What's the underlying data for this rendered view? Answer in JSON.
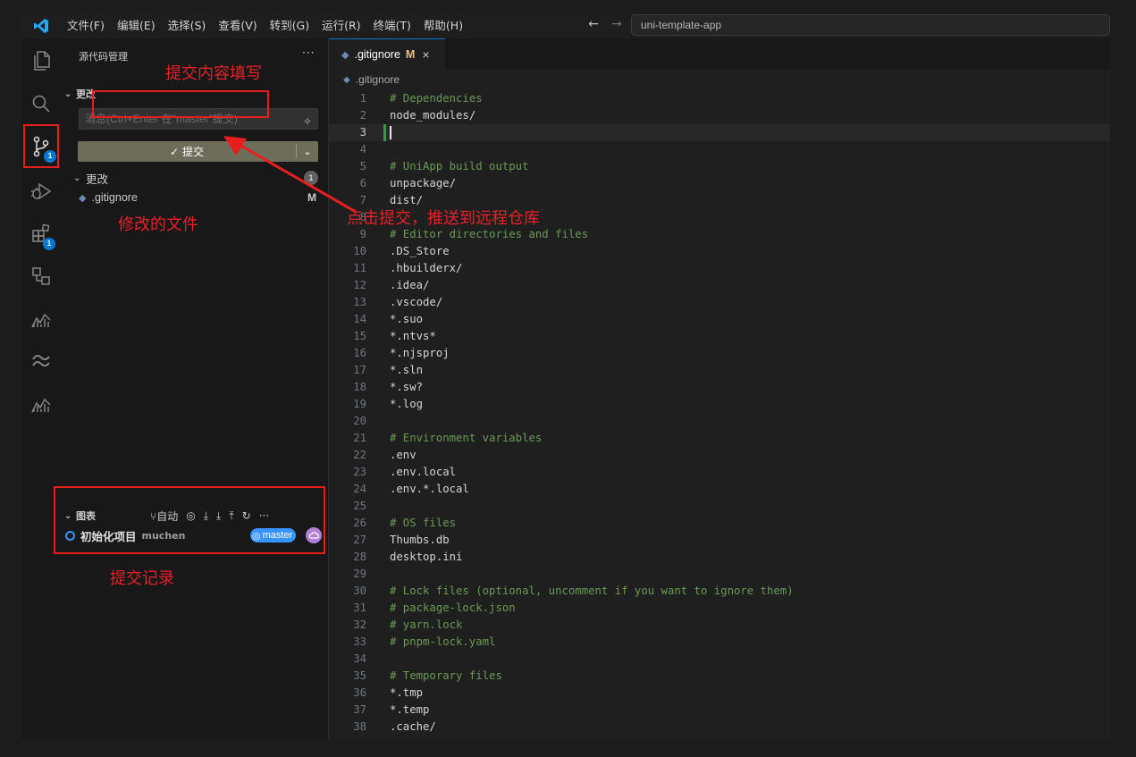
{
  "colors": {
    "accent": "#0078d4",
    "annotation": "#e81e1e",
    "commit_button": "#6e6d5a",
    "modified": "#e2c08d",
    "comment": "#6a9955"
  },
  "titlebar": {
    "menu": [
      "文件(F)",
      "编辑(E)",
      "选择(S)",
      "查看(V)",
      "转到(G)",
      "运行(R)",
      "终端(T)",
      "帮助(H)"
    ],
    "back_icon": "←",
    "forward_icon": "→",
    "command_center": "uni-template-app"
  },
  "activitybar": {
    "items": [
      {
        "icon": "explorer-icon"
      },
      {
        "icon": "search-icon"
      },
      {
        "icon": "source-control-icon",
        "badge": "1"
      },
      {
        "icon": "run-debug-icon"
      },
      {
        "icon": "extensions-icon",
        "badge": "1"
      },
      {
        "icon": "remote-explorer-icon"
      },
      {
        "icon": "chart-icon"
      },
      {
        "icon": "tailwind-icon"
      },
      {
        "icon": "chart-icon"
      }
    ]
  },
  "sidebar": {
    "title": "源代码管理",
    "more": "···",
    "changes_section": "更改",
    "message_placeholder": "消息(Ctrl+Enter 在\"master\"提交)",
    "commit_label": "提交",
    "check_icon": "✓",
    "dropdown_icon": "⌄",
    "changes_group": "更改",
    "changes_count": "1",
    "file": {
      "name": ".gitignore",
      "status": "M"
    },
    "graph": {
      "title": "图表",
      "auto_label": "自动",
      "more": "···",
      "commit": {
        "message": "初始化项目",
        "author": "muchen",
        "branch": "master"
      }
    }
  },
  "editor": {
    "tab": {
      "name": ".gitignore",
      "status": "M",
      "close": "×"
    },
    "breadcrumb": ".gitignore",
    "cursor_line": 3,
    "lines": [
      {
        "n": "1",
        "t": "# Dependencies",
        "c": true
      },
      {
        "n": "2",
        "t": "node_modules/",
        "c": false
      },
      {
        "n": "3",
        "t": "",
        "c": false
      },
      {
        "n": "4",
        "t": "",
        "c": false
      },
      {
        "n": "5",
        "t": "# UniApp build output",
        "c": true
      },
      {
        "n": "6",
        "t": "unpackage/",
        "c": false
      },
      {
        "n": "7",
        "t": "dist/",
        "c": false
      },
      {
        "n": "8",
        "t": "",
        "c": false
      },
      {
        "n": "9",
        "t": "# Editor directories and files",
        "c": true
      },
      {
        "n": "10",
        "t": ".DS_Store",
        "c": false
      },
      {
        "n": "11",
        "t": ".hbuilderx/",
        "c": false
      },
      {
        "n": "12",
        "t": ".idea/",
        "c": false
      },
      {
        "n": "13",
        "t": ".vscode/",
        "c": false
      },
      {
        "n": "14",
        "t": "*.suo",
        "c": false
      },
      {
        "n": "15",
        "t": "*.ntvs*",
        "c": false
      },
      {
        "n": "16",
        "t": "*.njsproj",
        "c": false
      },
      {
        "n": "17",
        "t": "*.sln",
        "c": false
      },
      {
        "n": "18",
        "t": "*.sw?",
        "c": false
      },
      {
        "n": "19",
        "t": "*.log",
        "c": false
      },
      {
        "n": "20",
        "t": "",
        "c": false
      },
      {
        "n": "21",
        "t": "# Environment variables",
        "c": true
      },
      {
        "n": "22",
        "t": ".env",
        "c": false
      },
      {
        "n": "23",
        "t": ".env.local",
        "c": false
      },
      {
        "n": "24",
        "t": ".env.*.local",
        "c": false
      },
      {
        "n": "25",
        "t": "",
        "c": false
      },
      {
        "n": "26",
        "t": "# OS files",
        "c": true
      },
      {
        "n": "27",
        "t": "Thumbs.db",
        "c": false
      },
      {
        "n": "28",
        "t": "desktop.ini",
        "c": false
      },
      {
        "n": "29",
        "t": "",
        "c": false
      },
      {
        "n": "30",
        "t": "# Lock files (optional, uncomment if you want to ignore them)",
        "c": true
      },
      {
        "n": "31",
        "t": "# package-lock.json",
        "c": true
      },
      {
        "n": "32",
        "t": "# yarn.lock",
        "c": true
      },
      {
        "n": "33",
        "t": "# pnpm-lock.yaml",
        "c": true
      },
      {
        "n": "34",
        "t": "",
        "c": false
      },
      {
        "n": "35",
        "t": "# Temporary files",
        "c": true
      },
      {
        "n": "36",
        "t": "*.tmp",
        "c": false
      },
      {
        "n": "37",
        "t": "*.temp",
        "c": false
      },
      {
        "n": "38",
        "t": ".cache/",
        "c": false
      }
    ]
  },
  "annotations": {
    "commit_message": "提交内容填写",
    "modified_files": "修改的文件",
    "click_commit": "点击提交，推送到远程仓库",
    "commit_history": "提交记录"
  }
}
